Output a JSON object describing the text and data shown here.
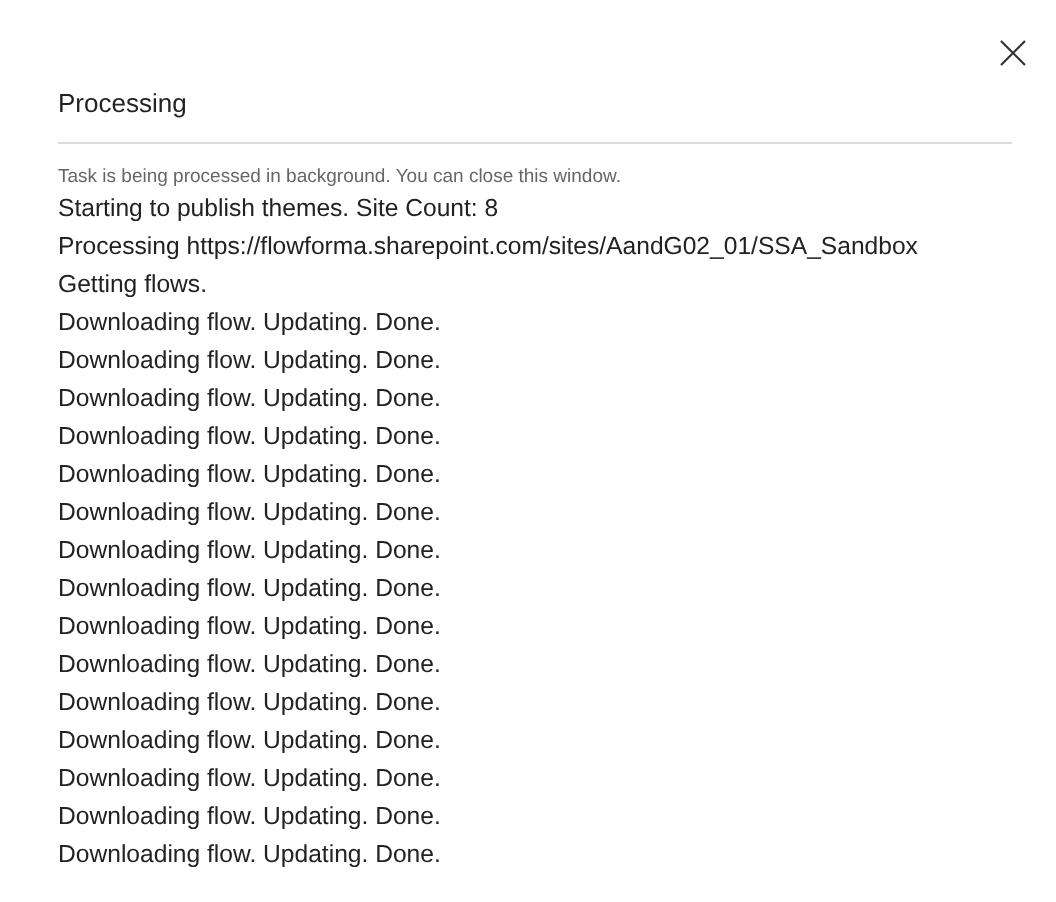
{
  "dialog": {
    "title": "Processing",
    "note": "Task is being processed in background. You can close this window.",
    "log": [
      "Starting to publish themes. Site Count: 8",
      "Processing https://flowforma.sharepoint.com/sites/AandG02_01/SSA_Sandbox",
      "Getting flows.",
      "Downloading flow. Updating. Done.",
      "Downloading flow. Updating. Done.",
      "Downloading flow. Updating. Done.",
      "Downloading flow. Updating. Done.",
      "Downloading flow. Updating. Done.",
      "Downloading flow. Updating. Done.",
      "Downloading flow. Updating. Done.",
      "Downloading flow. Updating. Done.",
      "Downloading flow. Updating. Done.",
      "Downloading flow. Updating. Done.",
      "Downloading flow. Updating. Done.",
      "Downloading flow. Updating. Done.",
      "Downloading flow. Updating. Done.",
      "Downloading flow. Updating. Done.",
      "Downloading flow. Updating. Done."
    ]
  }
}
